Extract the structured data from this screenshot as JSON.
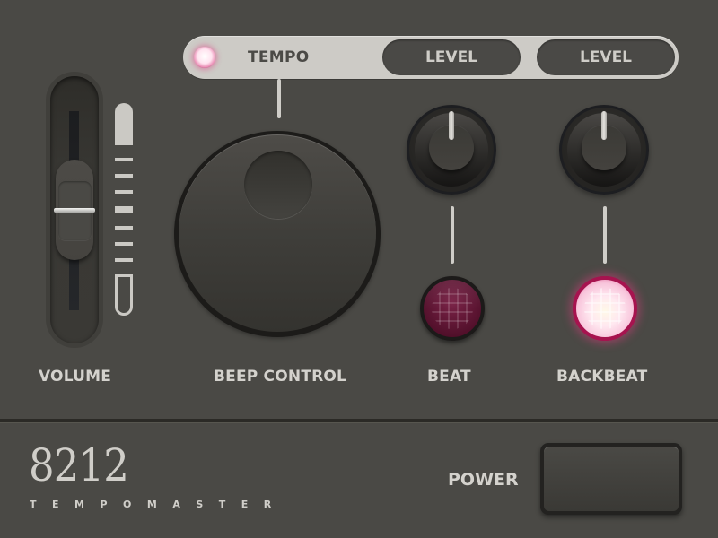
{
  "modebar": {
    "active_mode": "TEMPO",
    "tempo_label": "TEMPO",
    "level_1_label": "LEVEL",
    "level_2_label": "LEVEL",
    "indicator_state": "on"
  },
  "controls": {
    "volume": {
      "label": "VOLUME",
      "value_fraction": 0.5,
      "scale_ticks": 7
    },
    "beep_control": {
      "label": "BEEP CONTROL"
    },
    "beat": {
      "label": "BEAT",
      "knob_value_fraction": 0.5,
      "led_state": "off"
    },
    "backbeat": {
      "label": "BACKBEAT",
      "knob_value_fraction": 0.5,
      "led_state": "on"
    }
  },
  "footer": {
    "model_number": "8212",
    "brand_name": "TEMPOMASTER",
    "power_label": "POWER"
  },
  "colors": {
    "panel": "#4a4945",
    "light": "#cdcbc6",
    "accent_led": "#a7134f"
  }
}
